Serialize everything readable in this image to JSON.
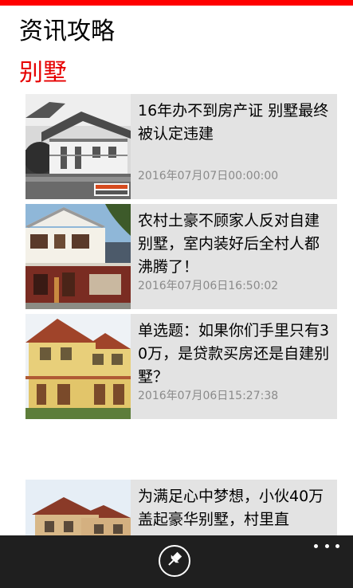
{
  "header": {
    "title": "资讯攻略",
    "section": "别墅"
  },
  "articles": [
    {
      "title": "16年办不到房产证 别墅最终被认定违建",
      "time": "2016年07月07日00:00:00",
      "thumb_icon": "grayscale-villa-photo"
    },
    {
      "title": "农村土豪不顾家人反对自建别墅，室内装好后全村人都沸腾了！",
      "time": "2016年07月06日16:50:02",
      "thumb_icon": "two-story-house-photo"
    },
    {
      "title": "单选题：如果你们手里只有30万，是贷款买房还是自建别墅？",
      "time": "2016年07月06日15:27:38",
      "thumb_icon": "yellow-villa-photo"
    },
    {
      "title": "为满足心中梦想，小伙40万盖起豪华别墅，村里直",
      "time": "",
      "thumb_icon": "tan-villa-photo"
    }
  ],
  "app_bar": {
    "pin_icon": "pin-icon",
    "more_icon": "more-icon"
  },
  "colors": {
    "accent": "#ff0000",
    "section_title": "#e60000",
    "card_bg": "#e3e3e3",
    "app_bar_bg": "#1f1f1f",
    "time_text": "#8a8a8a"
  }
}
